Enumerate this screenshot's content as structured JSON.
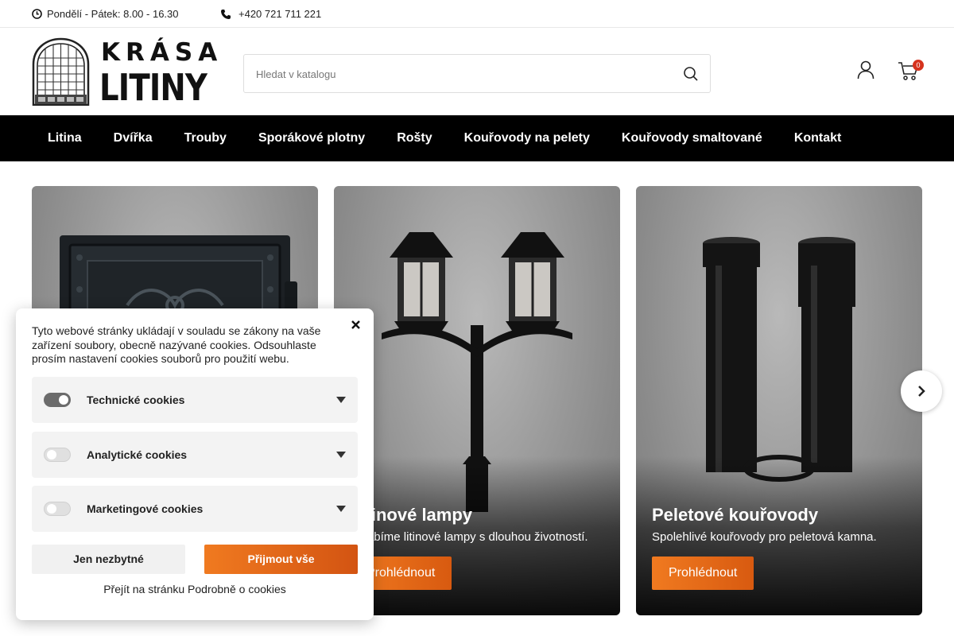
{
  "topbar": {
    "hours": "Pondělí - Pátek: 8.00 - 16.30",
    "phone": "+420 721 711 221"
  },
  "logo": {
    "line1": "KRÁSA",
    "line2": "LITINY"
  },
  "search": {
    "placeholder": "Hledat v katalogu"
  },
  "cart": {
    "count": "0"
  },
  "nav": {
    "items": [
      "Litina",
      "Dvířka",
      "Trouby",
      "Sporákové plotny",
      "Rošty",
      "Kouřovody na pelety",
      "Kouřovody smaltované",
      "Kontakt"
    ]
  },
  "cards": [
    {
      "title": "",
      "desc": "",
      "button": ""
    },
    {
      "title": "Litinové lampy",
      "desc": "Vyrábíme litinové lampy s dlouhou životností.",
      "button": "Prohlédnout"
    },
    {
      "title": "Peletové kouřovody",
      "desc": "Spolehlivé kouřovody pro peletová kamna.",
      "button": "Prohlédnout"
    }
  ],
  "cookie": {
    "intro": "Tyto webové stránky ukládají v souladu se zákony na vaše zařízení soubory, obecně nazývané cookies. Odsouhlaste prosím nastavení cookies souborů pro použití webu.",
    "categories": [
      {
        "label": "Technické cookies",
        "enabled": true
      },
      {
        "label": "Analytické cookies",
        "enabled": false
      },
      {
        "label": "Marketingové cookies",
        "enabled": false
      }
    ],
    "btn_necessary": "Jen nezbytné",
    "btn_accept": "Přijmout vše",
    "details_link": "Přejít na stránku Podrobně o cookies"
  },
  "colors": {
    "accent": "#e86a18",
    "nav_bg": "#000000",
    "badge": "#d6331e"
  }
}
